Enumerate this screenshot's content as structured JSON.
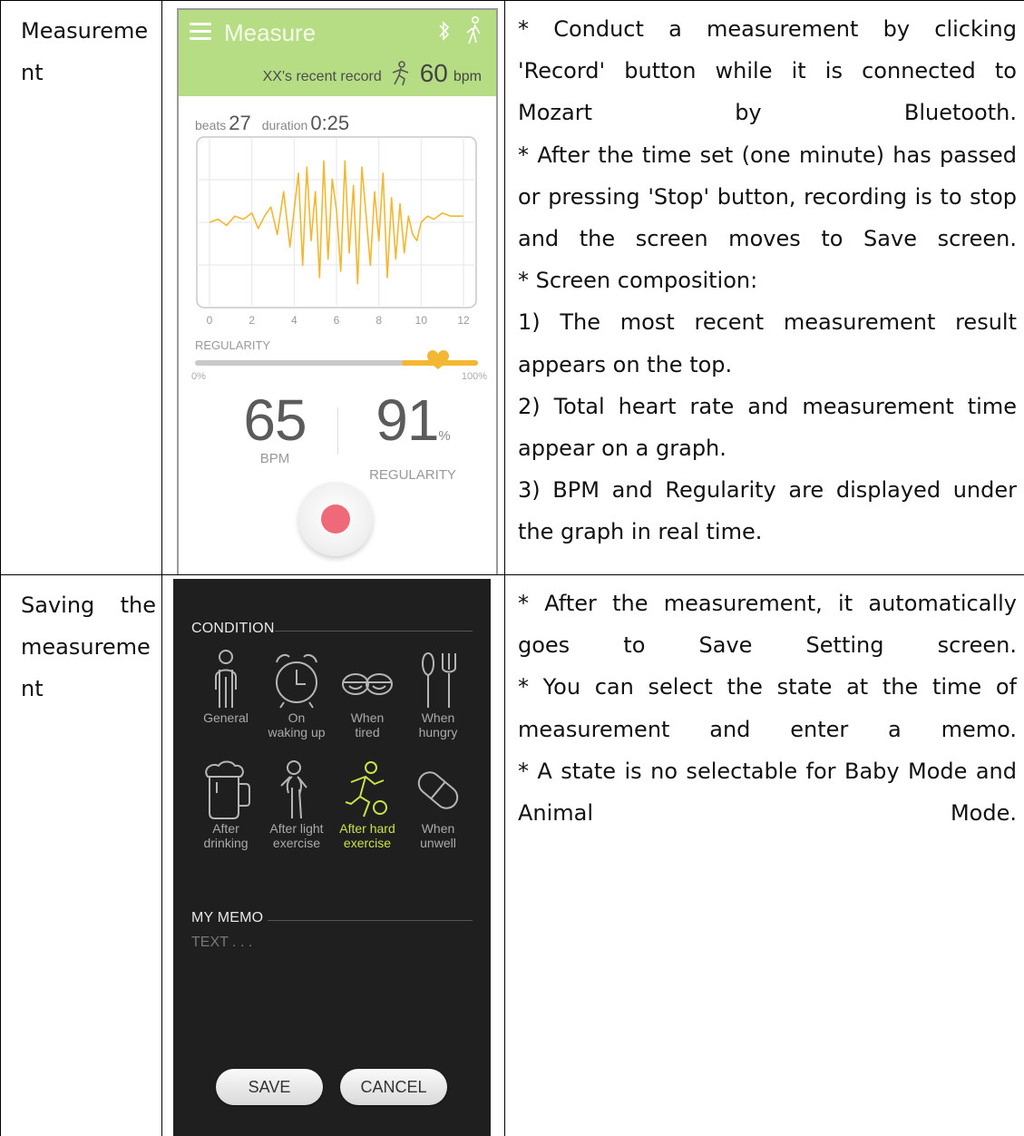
{
  "rows": [
    {
      "label_lines": [
        "Measureme",
        "nt"
      ],
      "desc": [
        "* Conduct a measurement by clicking 'Record' button while it is connected to Mozart by Bluetooth.",
        "* After the time set (one minute) has passed or pressing 'Stop' button, recording is to stop and the screen moves to Save screen.",
        "* Screen composition:",
        "1) The most recent measurement result appears on the top.",
        "2) Total heart rate and measurement time appear on a graph.",
        "3) BPM and Regularity are displayed under the graph in real time."
      ]
    },
    {
      "label_lines": [
        "Saving the",
        "measureme",
        "nt"
      ],
      "desc": [
        "* After the measurement, it automatically goes to Save Setting screen.",
        "* You can select the state at the time of measurement and enter a memo.",
        "* A state is no selectable for Baby Mode and Animal Mode."
      ]
    }
  ],
  "measure_screen": {
    "title": "Measure",
    "recent_label": "XX's recent record",
    "recent_bpm": "60",
    "bpm_unit": "bpm",
    "beats_label": "beats",
    "beats_value": "27",
    "duration_label": "duration",
    "duration_value": "0:25",
    "regularity_label": "REGULARITY",
    "regularity_min": "0%",
    "regularity_max": "100%",
    "regularity_level": 0.86,
    "bpm_value": "65",
    "bpm_caption": "BPM",
    "regularity_value": "91",
    "regularity_pct": "%",
    "regularity_caption": "REGULARITY",
    "header_color": "#b6dd84",
    "accent_color": "#f2b733",
    "record_color": "#ef6a78"
  },
  "chart_data": {
    "type": "line",
    "xlim": [
      0,
      12
    ],
    "ticks_x": [
      "0",
      "2",
      "4",
      "6",
      "8",
      "10",
      "12"
    ],
    "grid": true,
    "series_color": "#f2b733",
    "x": [
      0,
      0.4,
      0.8,
      1.2,
      1.6,
      2.0,
      2.3,
      2.6,
      2.9,
      3.2,
      3.5,
      3.8,
      4.0,
      4.2,
      4.4,
      4.6,
      4.8,
      5.0,
      5.2,
      5.4,
      5.6,
      5.8,
      6.0,
      6.2,
      6.4,
      6.6,
      6.8,
      7.0,
      7.2,
      7.4,
      7.6,
      7.8,
      8.0,
      8.2,
      8.4,
      8.6,
      8.8,
      9.0,
      9.2,
      9.4,
      9.6,
      9.8,
      10.0,
      10.3,
      10.6,
      11.0,
      11.4,
      12.0
    ],
    "y": [
      0,
      0.05,
      -0.05,
      0.1,
      0.05,
      0.15,
      -0.1,
      0.1,
      0.25,
      -0.2,
      0.5,
      -0.4,
      0.2,
      0.8,
      -0.7,
      0.9,
      -0.3,
      0.5,
      -0.9,
      1.0,
      -0.6,
      0.7,
      0.2,
      -0.8,
      1.0,
      -0.5,
      0.6,
      -1.0,
      0.9,
      0.1,
      -0.7,
      0.5,
      -0.3,
      0.8,
      -0.9,
      0.4,
      -0.6,
      0.3,
      -0.5,
      0.1,
      -0.2,
      -0.3,
      0.0,
      0.1,
      0.05,
      0.15,
      0.1,
      0.1
    ]
  },
  "condition_screen": {
    "condition_label": "CONDITION",
    "items": [
      {
        "label1": "General",
        "label2": "",
        "icon": "person-icon"
      },
      {
        "label1": "On",
        "label2": "waking up",
        "icon": "alarm-clock-icon"
      },
      {
        "label1": "When",
        "label2": "tired",
        "icon": "tired-eyes-icon"
      },
      {
        "label1": "When",
        "label2": "hungry",
        "icon": "fork-knife-icon"
      },
      {
        "label1": "After",
        "label2": "drinking",
        "icon": "beer-mug-icon"
      },
      {
        "label1": "After light",
        "label2": "exercise",
        "icon": "walking-icon"
      },
      {
        "label1": "After hard",
        "label2": "exercise",
        "icon": "running-icon"
      },
      {
        "label1": "When",
        "label2": "unwell",
        "icon": "pill-icon"
      }
    ],
    "selected_index": 6,
    "active_color": "#c8e34a",
    "memo_label": "MY MEMO",
    "memo_placeholder": "TEXT . . .",
    "save_label": "SAVE",
    "cancel_label": "CANCEL"
  }
}
